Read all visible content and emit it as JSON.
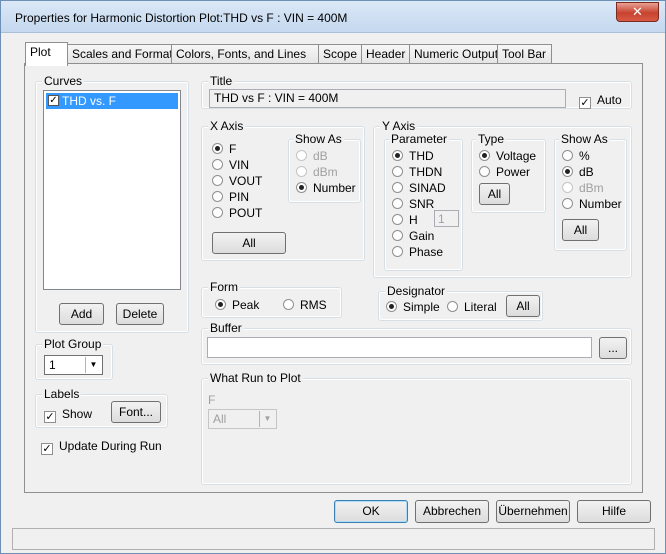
{
  "window": {
    "title": "Properties for Harmonic Distortion Plot:THD vs F : VIN = 400M",
    "close_glyph": "✕"
  },
  "tabs": [
    {
      "label": "Plot"
    },
    {
      "label": "Scales and Formats"
    },
    {
      "label": "Colors, Fonts, and Lines"
    },
    {
      "label": "Scope"
    },
    {
      "label": "Header"
    },
    {
      "label": "Numeric Output"
    },
    {
      "label": "Tool Bar"
    }
  ],
  "curves": {
    "legend": "Curves",
    "items": [
      {
        "label": "THD vs. F",
        "checked": true
      }
    ],
    "add_label": "Add",
    "delete_label": "Delete"
  },
  "plot_group": {
    "legend": "Plot Group",
    "value": "1"
  },
  "labels": {
    "legend": "Labels",
    "show_label": "Show",
    "font_label": "Font..."
  },
  "update_during_run": {
    "label": "Update During Run"
  },
  "title_group": {
    "legend": "Title",
    "value": "THD vs F : VIN = 400M",
    "auto_label": "Auto"
  },
  "x_axis": {
    "legend": "X Axis",
    "options": [
      "F",
      "VIN",
      "VOUT",
      "PIN",
      "POUT"
    ],
    "all_label": "All",
    "show_as": {
      "legend": "Show As",
      "options": [
        "dB",
        "dBm",
        "Number"
      ]
    }
  },
  "y_axis": {
    "legend": "Y Axis",
    "parameter": {
      "legend": "Parameter",
      "options": [
        "THD",
        "THDN",
        "SINAD",
        "SNR",
        "H",
        "Gain",
        "Phase"
      ],
      "h_value": "1"
    },
    "type": {
      "legend": "Type",
      "options": [
        "Voltage",
        "Power"
      ],
      "all_label": "All"
    },
    "show_as": {
      "legend": "Show As",
      "options": [
        "%",
        "dB",
        "dBm",
        "Number"
      ],
      "all_label": "All"
    }
  },
  "form": {
    "legend": "Form",
    "options": [
      "Peak",
      "RMS"
    ]
  },
  "designator": {
    "legend": "Designator",
    "options": [
      "Simple",
      "Literal"
    ],
    "all_label": "All"
  },
  "buffer": {
    "legend": "Buffer",
    "value": "",
    "browse_label": "..."
  },
  "what_run": {
    "legend": "What Run to Plot",
    "sub_label": "F",
    "select_value": "All"
  },
  "footer": {
    "ok_label": "OK",
    "cancel_label": "Abbrechen",
    "apply_label": "Übernehmen",
    "help_label": "Hilfe"
  }
}
